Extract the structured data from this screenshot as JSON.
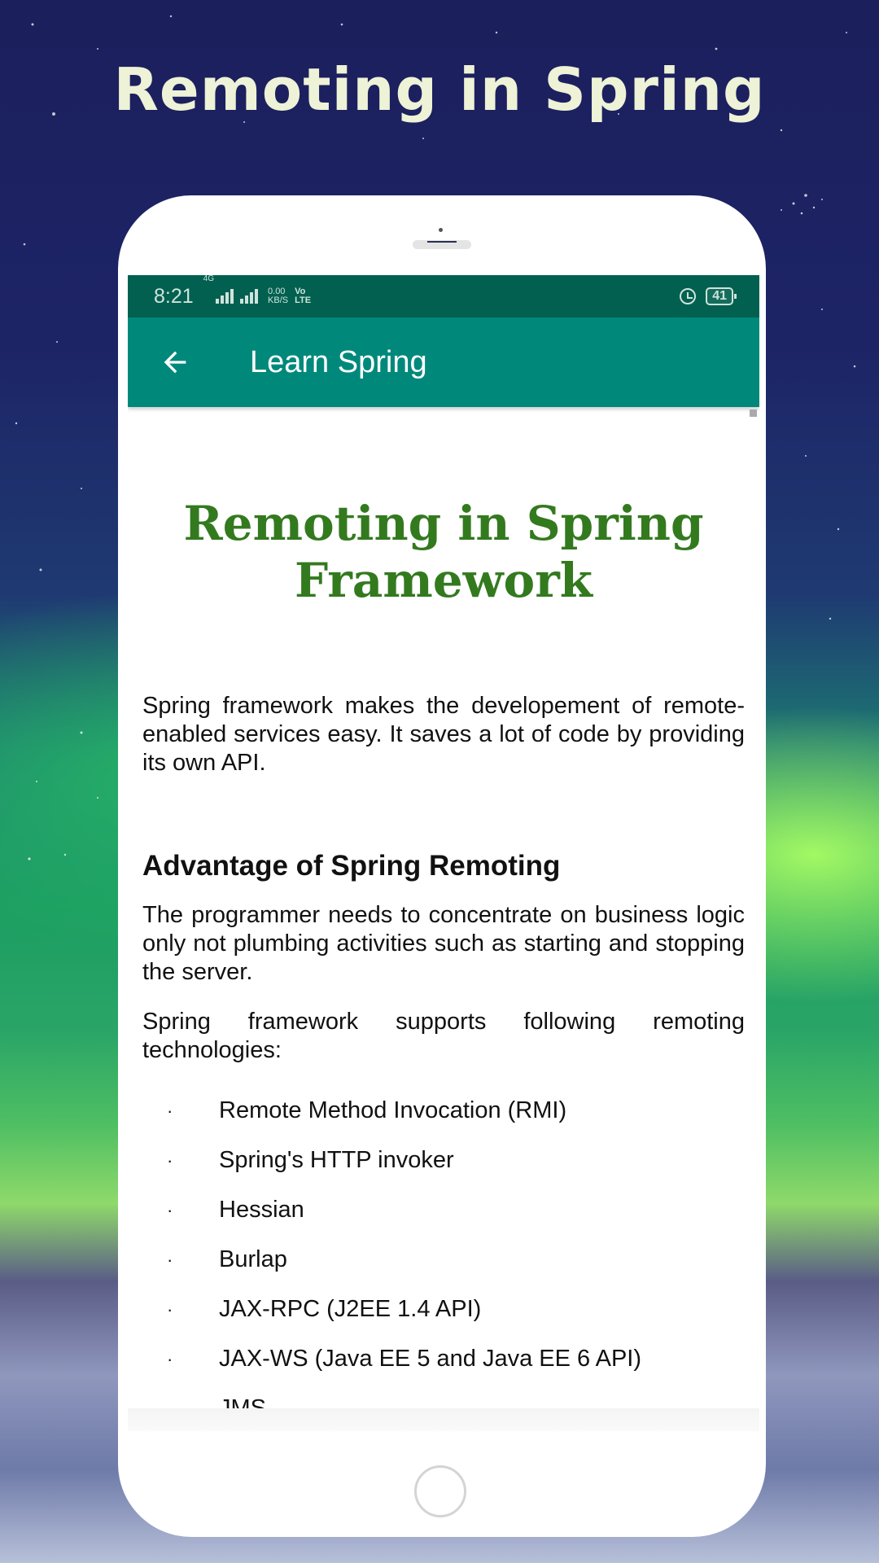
{
  "promo": {
    "title": "Remoting in Spring"
  },
  "statusbar": {
    "time": "8:21",
    "network_type": "4G",
    "speed_value": "0.00",
    "speed_unit": "KB/S",
    "volte_top": "Vo",
    "volte_bottom": "LTE",
    "battery": "41",
    "icons": [
      "signal-4g-icon",
      "signal-icon",
      "volte-icon",
      "alarm-icon",
      "battery-icon"
    ]
  },
  "appbar": {
    "title": "Learn Spring",
    "back_icon": "arrow-left-icon"
  },
  "article": {
    "title": "Remoting in Spring Framework",
    "intro": "Spring framework makes the developement of remote-enabled services easy. It saves a lot of code by providing its own API.",
    "section_heading": "Advantage of Spring Remoting",
    "paragraph_2": "The programmer needs to concentrate on business logic only not plumbing activities such as starting and stopping the server.",
    "paragraph_3": "Spring framework supports following remoting technologies:",
    "bullet_symbol": "·",
    "technologies": [
      "Remote Method Invocation (RMI)",
      "Spring's HTTP invoker",
      "Hessian",
      "Burlap",
      "JAX-RPC (J2EE 1.4 API)",
      "JAX-WS (Java EE 5 and Java EE 6 API)",
      "JMS"
    ]
  },
  "colors": {
    "statusbar": "#01604f",
    "appbar": "#00897b",
    "article_title": "#337a1f",
    "promo_title": "#eef2d6"
  }
}
